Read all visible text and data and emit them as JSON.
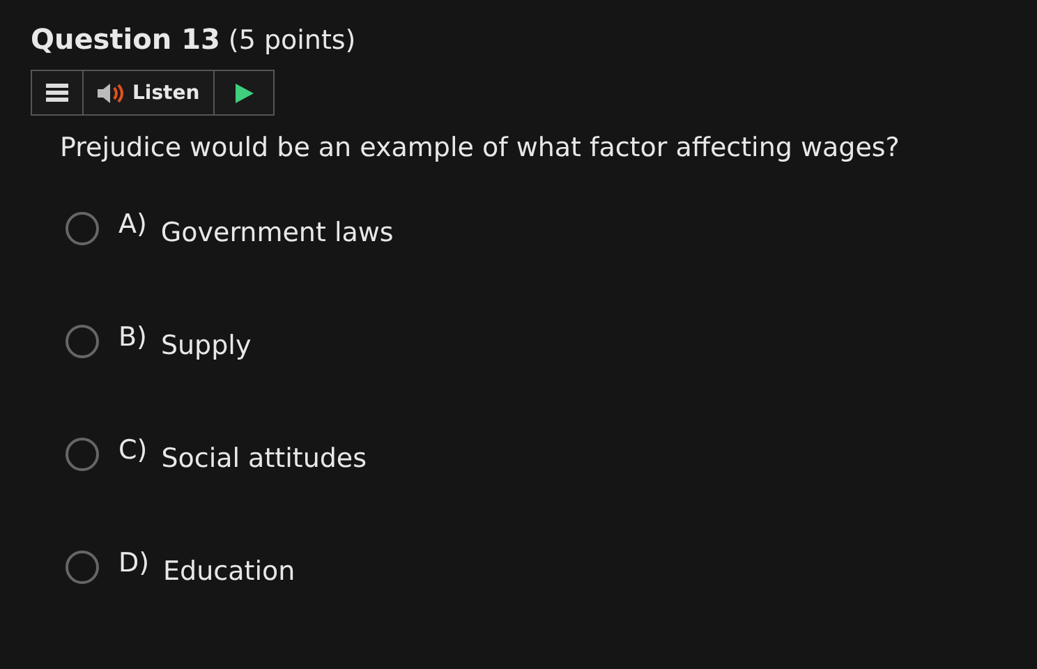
{
  "question": {
    "title": "Question 13",
    "points": "(5 points)"
  },
  "toolbar": {
    "listen": "Listen"
  },
  "prompt": "Prejudice would be an example of what factor affecting wages?",
  "options": [
    {
      "letter": "A)",
      "text": "Government laws",
      "selected": false
    },
    {
      "letter": "B)",
      "text": "Supply",
      "selected": false
    },
    {
      "letter": "C)",
      "text": "Social attitudes",
      "selected": false
    },
    {
      "letter": "D)",
      "text": "Education",
      "selected": false
    }
  ]
}
